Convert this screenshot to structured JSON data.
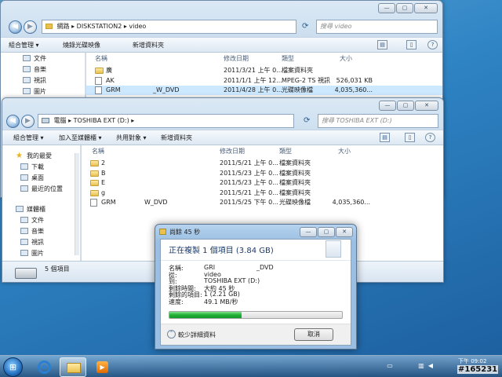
{
  "back_window": {
    "address": {
      "root": "網路",
      "host": "DISKSTATION2",
      "folder": "video"
    },
    "search_placeholder": "搜尋 video",
    "toolbar": {
      "organize": "組合管理 ▾",
      "burn": "燒錄光碟映像",
      "new_folder": "新增資料夾"
    },
    "nav_pane": [
      "文件",
      "音樂",
      "視訊",
      "圖片"
    ],
    "columns": {
      "name": "名稱",
      "date": "修改日期",
      "type": "類型",
      "size": "大小"
    },
    "files": [
      {
        "name": "廣",
        "date": "2011/3/21 上午 0...",
        "type": "檔案資料夾",
        "size": "",
        "kind": "folder"
      },
      {
        "name": "AK",
        "date": "2011/1/1 上午 12...",
        "type": "MPEG-2 TS 視訊",
        "size": "526,031 KB",
        "kind": "file"
      },
      {
        "name": "GRM",
        "name_tail": "_W_DVD",
        "date": "2011/4/28 上午 0...",
        "type": "光碟映像檔",
        "size": "4,035,360...",
        "kind": "file"
      }
    ]
  },
  "front_window": {
    "address": {
      "root": "電腦",
      "drive": "TOSHIBA EXT (D:)"
    },
    "search_placeholder": "搜尋 TOSHIBA EXT (D:)",
    "toolbar": {
      "organize": "組合管理 ▾",
      "include": "加入至媒體櫃 ▾",
      "share": "共用對象 ▾",
      "new_folder": "新增資料夾"
    },
    "nav_pane": {
      "favorites_header": "我的最愛",
      "favorites": [
        "下載",
        "桌面",
        "最近的位置"
      ],
      "libraries_header": "媒體櫃",
      "libraries": [
        "文件",
        "音樂",
        "視訊",
        "圖片"
      ]
    },
    "columns": {
      "name": "名稱",
      "date": "修改日期",
      "type": "類型",
      "size": "大小"
    },
    "files": [
      {
        "name": "2",
        "date": "2011/5/21 上午 0...",
        "type": "檔案資料夾",
        "size": "",
        "kind": "folder"
      },
      {
        "name": "B",
        "date": "2011/5/23 上午 0...",
        "type": "檔案資料夾",
        "size": "",
        "kind": "folder"
      },
      {
        "name": "E",
        "date": "2011/5/23 上午 0...",
        "type": "檔案資料夾",
        "size": "",
        "kind": "folder"
      },
      {
        "name": "g",
        "date": "2011/5/21 上午 0...",
        "type": "檔案資料夾",
        "size": "",
        "kind": "folder"
      },
      {
        "name": "GRM",
        "name_tail": "W_DVD",
        "date": "2011/5/25 下午 0...",
        "type": "光碟映像檔",
        "size": "4,035,360...",
        "kind": "file"
      }
    ],
    "status_count": "5 個項目"
  },
  "copy_dialog": {
    "title": "尚餘 45 秒",
    "heading": "正在複製 1 個項目 (3.84 GB)",
    "rows": [
      {
        "label": "名稱:",
        "value": "GRI",
        "value_tail": "_DVD"
      },
      {
        "label": "從:",
        "value": "video"
      },
      {
        "label": "到:",
        "value": "TOSHIBA EXT (D:)"
      },
      {
        "label": "剩餘時間:",
        "value": "大約 45 秒"
      },
      {
        "label": "剩餘的項目:",
        "value": "1 (2.21 GB)"
      },
      {
        "label": "速度:",
        "value": "49.1 MB/秒"
      }
    ],
    "progress_fraction": 0.42,
    "less_details": "較少詳細資料",
    "cancel": "取消"
  },
  "taskbar": {
    "clock_line": "下午 09:02",
    "watermark": "#165231"
  },
  "colors": {
    "progress": "#21b035",
    "desktop": "#2f84c4",
    "selection": "#cce8ff"
  }
}
